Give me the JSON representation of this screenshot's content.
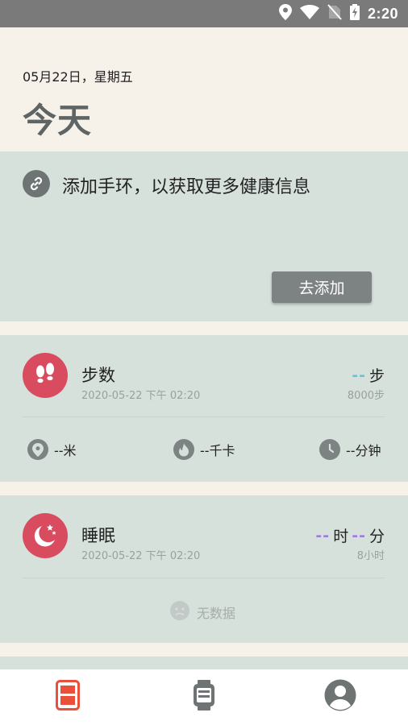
{
  "status_bar": {
    "time": "2:20",
    "icons": [
      "location-icon",
      "wifi-icon",
      "no-sim-icon",
      "battery-charging-icon"
    ]
  },
  "header": {
    "date": "05月22日，星期五",
    "title": "今天"
  },
  "add_band": {
    "message": "添加手环，以获取更多健康信息",
    "button_label": "去添加",
    "icon": "link-icon"
  },
  "steps": {
    "title": "步数",
    "timestamp": "2020-05-22 下午 02:20",
    "value": "--",
    "unit": "步",
    "goal": "8000步",
    "icon": "footprints-icon",
    "sub": [
      {
        "icon": "location-pin-icon",
        "label": "--米"
      },
      {
        "icon": "flame-icon",
        "label": "--千卡"
      },
      {
        "icon": "clock-icon",
        "label": "--分钟"
      }
    ]
  },
  "sleep": {
    "title": "睡眠",
    "timestamp": "2020-05-22 下午 02:20",
    "hours_value": "--",
    "hours_unit": "时",
    "minutes_value": "--",
    "minutes_unit": "分",
    "goal": "8小时",
    "icon": "moon-stars-icon",
    "empty_text": "无数据"
  },
  "tabs": [
    {
      "name": "today-tab",
      "icon": "phone-icon",
      "active": true
    },
    {
      "name": "device-tab",
      "icon": "watch-icon",
      "active": false
    },
    {
      "name": "profile-tab",
      "icon": "user-icon",
      "active": false
    }
  ],
  "colors": {
    "accent": "#d94b5e",
    "active_tab": "#e8503a",
    "card_bg": "#d7e1dc",
    "page_bg": "#f6f2ea",
    "steps_dash": "#5fc7d8",
    "sleep_dash": "#a07be0"
  }
}
